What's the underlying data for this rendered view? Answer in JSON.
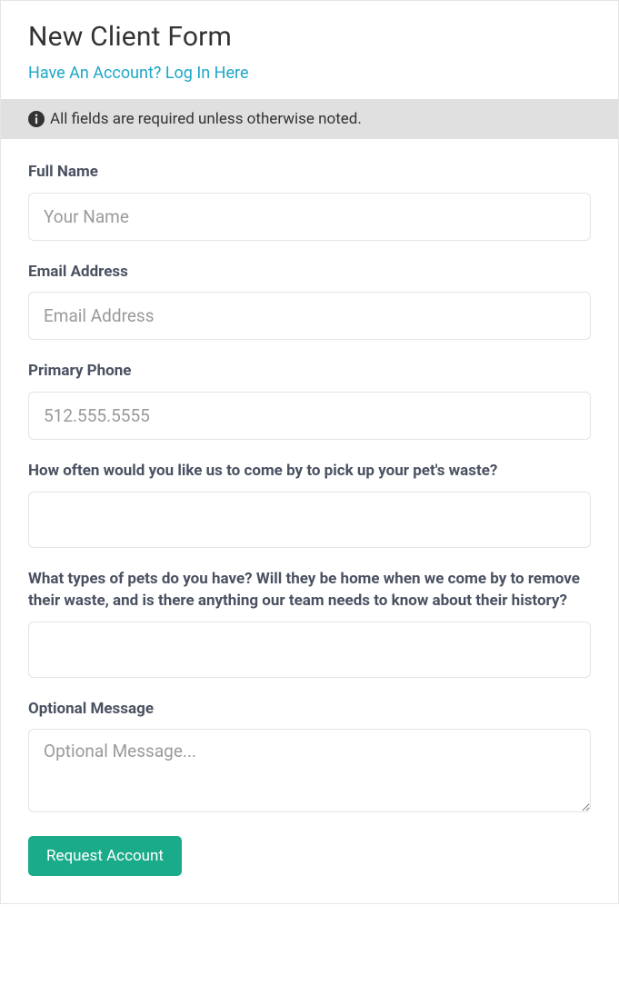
{
  "header": {
    "title": "New Client Form",
    "login_link": "Have An Account? Log In Here"
  },
  "notice": {
    "text": "All fields are required unless otherwise noted."
  },
  "form": {
    "full_name": {
      "label": "Full Name",
      "placeholder": "Your Name"
    },
    "email": {
      "label": "Email Address",
      "placeholder": "Email Address"
    },
    "phone": {
      "label": "Primary Phone",
      "placeholder": "512.555.5555"
    },
    "frequency": {
      "label": "How often would you like us to come by to pick up your pet's waste?"
    },
    "pets": {
      "label": "What types of pets do you have? Will they be home when we come by to remove their waste, and is there anything our team needs to know about their history?"
    },
    "message": {
      "label": "Optional Message",
      "placeholder": "Optional Message..."
    },
    "submit_label": "Request Account"
  }
}
